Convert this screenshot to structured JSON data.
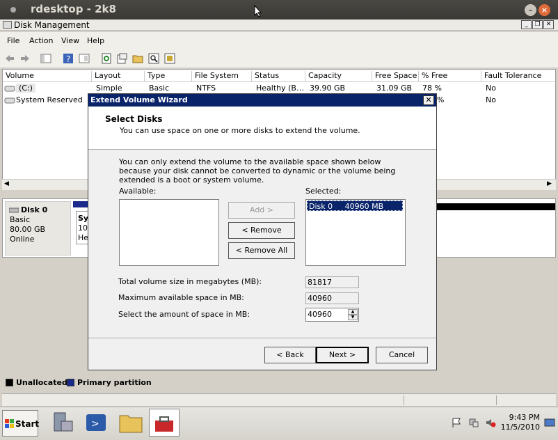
{
  "window": {
    "outer_title": "rdesktop - 2k8",
    "app_title": "Disk Management"
  },
  "menu": [
    "File",
    "Action",
    "View",
    "Help"
  ],
  "volumes": {
    "headers": [
      "Volume",
      "Layout",
      "Type",
      "File System",
      "Status",
      "Capacity",
      "Free Space",
      "% Free",
      "Fault Tolerance"
    ],
    "rows": [
      [
        "(C:)",
        "Simple",
        "Basic",
        "NTFS",
        "Healthy (B…",
        "39.90 GB",
        "31.09 GB",
        "78 %",
        "No"
      ],
      [
        "System Reserved",
        "",
        "",
        "",
        "",
        "",
        "",
        "%",
        "No"
      ]
    ]
  },
  "disk": {
    "name": "Disk 0",
    "type": "Basic",
    "size": "80.00 GB",
    "status": "Online",
    "part1_a": "Sy",
    "part1_b": "10",
    "part1_c": "He"
  },
  "legend": {
    "unallocated": "Unallocated",
    "primary": "Primary partition"
  },
  "dialog": {
    "title": "Extend Volume Wizard",
    "header_title": "Select Disks",
    "header_sub": "You can use space on one or more disks to extend the volume.",
    "note": "You can only extend the volume to the available space shown below because your disk cannot be converted to dynamic or the volume being extended is a boot or system volume.",
    "available_label": "Available:",
    "selected_label": "Selected:",
    "selected_item": "Disk 0     40960 MB",
    "add_btn": "Add >",
    "remove_btn": "< Remove",
    "remove_all_btn": "< Remove All",
    "total_label": "Total volume size in megabytes (MB):",
    "total_value": "81817",
    "max_label": "Maximum available space in MB:",
    "max_value": "40960",
    "amount_label": "Select the amount of space in MB:",
    "amount_value": "40960",
    "back_btn": "< Back",
    "next_btn": "Next >",
    "cancel_btn": "Cancel"
  },
  "taskbar": {
    "start": "Start",
    "time": "9:43 PM",
    "date": "11/5/2010"
  }
}
